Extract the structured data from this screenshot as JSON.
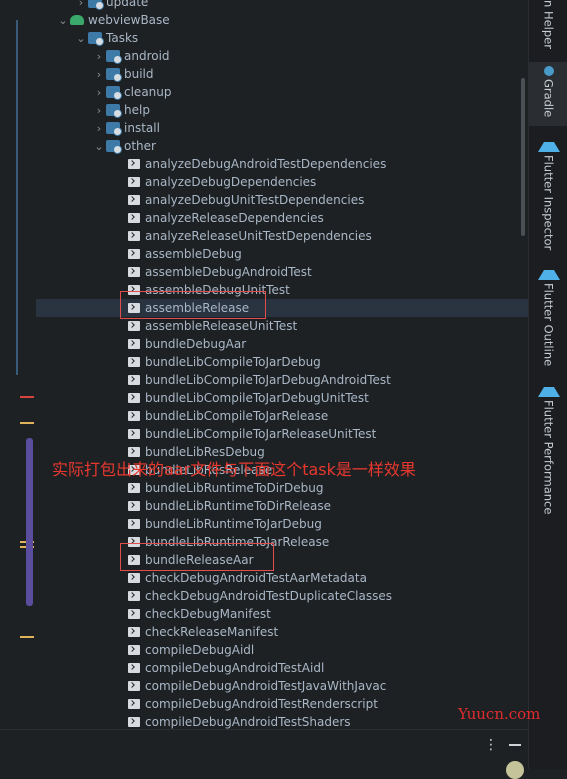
{
  "tree": {
    "rows": [
      {
        "label": "update",
        "kind": "folder",
        "level": 1
      },
      {
        "label": "webviewBase",
        "kind": "project",
        "level": 0,
        "expanded": true
      },
      {
        "label": "Tasks",
        "kind": "folder",
        "level": 1,
        "expanded": true
      },
      {
        "label": "android",
        "kind": "folder",
        "level": 2
      },
      {
        "label": "build",
        "kind": "folder",
        "level": 2
      },
      {
        "label": "cleanup",
        "kind": "folder",
        "level": 2
      },
      {
        "label": "help",
        "kind": "folder",
        "level": 2
      },
      {
        "label": "install",
        "kind": "folder",
        "level": 2
      },
      {
        "label": "other",
        "kind": "folder",
        "level": 2,
        "expanded": true
      },
      {
        "label": "analyzeDebugAndroidTestDependencies",
        "kind": "task"
      },
      {
        "label": "analyzeDebugDependencies",
        "kind": "task"
      },
      {
        "label": "analyzeDebugUnitTestDependencies",
        "kind": "task"
      },
      {
        "label": "analyzeReleaseDependencies",
        "kind": "task"
      },
      {
        "label": "analyzeReleaseUnitTestDependencies",
        "kind": "task"
      },
      {
        "label": "assembleDebug",
        "kind": "task"
      },
      {
        "label": "assembleDebugAndroidTest",
        "kind": "task"
      },
      {
        "label": "assembleDebugUnitTest",
        "kind": "task"
      },
      {
        "label": "assembleRelease",
        "kind": "task",
        "selected": true,
        "boxed": true
      },
      {
        "label": "assembleReleaseUnitTest",
        "kind": "task"
      },
      {
        "label": "bundleDebugAar",
        "kind": "task"
      },
      {
        "label": "bundleLibCompileToJarDebug",
        "kind": "task"
      },
      {
        "label": "bundleLibCompileToJarDebugAndroidTest",
        "kind": "task"
      },
      {
        "label": "bundleLibCompileToJarDebugUnitTest",
        "kind": "task"
      },
      {
        "label": "bundleLibCompileToJarRelease",
        "kind": "task"
      },
      {
        "label": "bundleLibCompileToJarReleaseUnitTest",
        "kind": "task"
      },
      {
        "label": "bundleLibResDebug",
        "kind": "task"
      },
      {
        "label": "bundleLibResRelease",
        "kind": "task"
      },
      {
        "label": "bundleLibRuntimeToDirDebug",
        "kind": "task"
      },
      {
        "label": "bundleLibRuntimeToDirRelease",
        "kind": "task"
      },
      {
        "label": "bundleLibRuntimeToJarDebug",
        "kind": "task"
      },
      {
        "label": "bundleLibRuntimeToJarRelease",
        "kind": "task"
      },
      {
        "label": "bundleReleaseAar",
        "kind": "task",
        "boxed": true
      },
      {
        "label": "checkDebugAndroidTestAarMetadata",
        "kind": "task"
      },
      {
        "label": "checkDebugAndroidTestDuplicateClasses",
        "kind": "task"
      },
      {
        "label": "checkDebugManifest",
        "kind": "task"
      },
      {
        "label": "checkReleaseManifest",
        "kind": "task"
      },
      {
        "label": "compileDebugAidl",
        "kind": "task"
      },
      {
        "label": "compileDebugAndroidTestAidl",
        "kind": "task"
      },
      {
        "label": "compileDebugAndroidTestJavaWithJavac",
        "kind": "task"
      },
      {
        "label": "compileDebugAndroidTestRenderscript",
        "kind": "task"
      },
      {
        "label": "compileDebugAndroidTestShaders",
        "kind": "task"
      }
    ]
  },
  "annotation": "实际打包出来的aar文件与下面这个task是一样效果",
  "side_tabs": [
    {
      "label": "n Helper",
      "icon": "none"
    },
    {
      "label": "Gradle",
      "icon": "gradle-icon",
      "active": true
    },
    {
      "label": "Flutter Inspector",
      "icon": "flutter-icon"
    },
    {
      "label": "Flutter Outline",
      "icon": "flutter-icon"
    },
    {
      "label": "Flutter Performance",
      "icon": "flutter-icon"
    }
  ],
  "watermark": "Yuucn.com",
  "colors": {
    "annotation": "#e8382e",
    "highlight_box": "#e24c4c",
    "selection": "#2a3340",
    "text": "#a9b7c6"
  }
}
